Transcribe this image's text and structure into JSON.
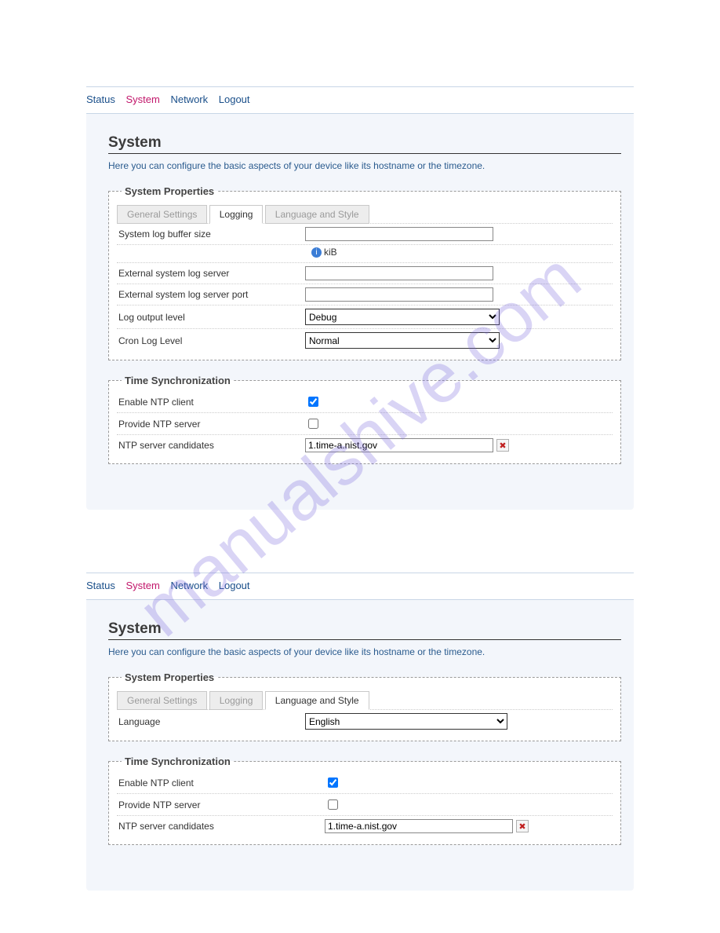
{
  "watermark": "manualshive.com",
  "nav": {
    "status": "Status",
    "system": "System",
    "network": "Network",
    "logout": "Logout"
  },
  "page": {
    "title": "System",
    "desc": "Here you can configure the basic aspects of your device like its hostname or the timezone."
  },
  "sysprops": {
    "legend": "System Properties",
    "tabs": {
      "general": "General Settings",
      "logging": "Logging",
      "language": "Language and Style"
    }
  },
  "logging": {
    "buffer_label": "System log buffer size",
    "buffer_value": "",
    "buffer_hint": "kiB",
    "ext_server_label": "External system log server",
    "ext_server_value": "",
    "ext_port_label": "External system log server port",
    "ext_port_value": "",
    "output_level_label": "Log output level",
    "output_level_value": "Debug",
    "cron_level_label": "Cron Log Level",
    "cron_level_value": "Normal"
  },
  "language": {
    "label": "Language",
    "value": "English"
  },
  "timesync": {
    "legend": "Time Synchronization",
    "enable_label": "Enable NTP client",
    "enable_checked": true,
    "provide_label": "Provide NTP server",
    "provide_checked": false,
    "candidates_label": "NTP server candidates",
    "candidate_value": "1.time-a.nist.gov"
  }
}
